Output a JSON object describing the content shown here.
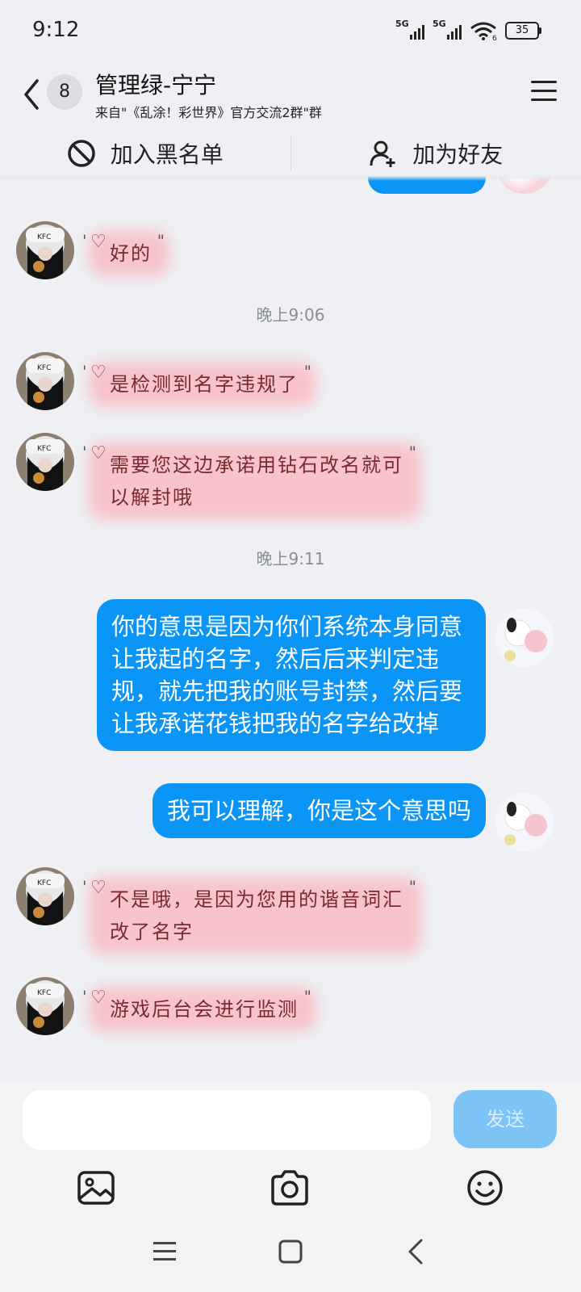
{
  "status": {
    "time": "9:12",
    "signal1": "5G",
    "signal2": "5G",
    "wifi_note": "6",
    "battery": "35"
  },
  "header": {
    "unread_count": "8",
    "title": "管理绿-宁宁",
    "subtitle": "来自\"《乱涂！彩世界》官方交流2群\"群"
  },
  "actions": {
    "blacklist": "加入黑名单",
    "add_friend": "加为好友"
  },
  "messages": [
    {
      "from": "other",
      "text": "好的"
    },
    {
      "time": "晚上9:06"
    },
    {
      "from": "other",
      "text": "是检测到名字违规了"
    },
    {
      "from": "other",
      "lines": [
        "需要您这边承诺用钻石改名就可",
        "以解封哦"
      ]
    },
    {
      "time": "晚上9:11"
    },
    {
      "from": "me",
      "lines": [
        "你的意思是因为你们系统本身同意",
        "让我起的名字，然后后来判定违",
        "规，就先把我的账号封禁，然后要",
        "让我承诺花钱把我的名字给改掉"
      ]
    },
    {
      "from": "me",
      "text": "我可以理解，你是这个意思吗"
    },
    {
      "from": "other",
      "lines": [
        "不是哦，是因为您用的谐音词汇",
        "改了名字"
      ]
    },
    {
      "from": "other",
      "text": "游戏后台会进行监测"
    }
  ],
  "input": {
    "placeholder": "",
    "send_label": "发送"
  },
  "colors": {
    "my_bubble": "#0a95f6",
    "send_disabled": "#7cc3f6",
    "fancy_glow": "#ffa0aa"
  },
  "icons": [
    "back-icon",
    "menu-icon",
    "block-icon",
    "add-friend-icon",
    "image-icon",
    "camera-icon",
    "emoji-icon",
    "nav-menu-icon",
    "nav-home-icon",
    "nav-back-icon"
  ]
}
